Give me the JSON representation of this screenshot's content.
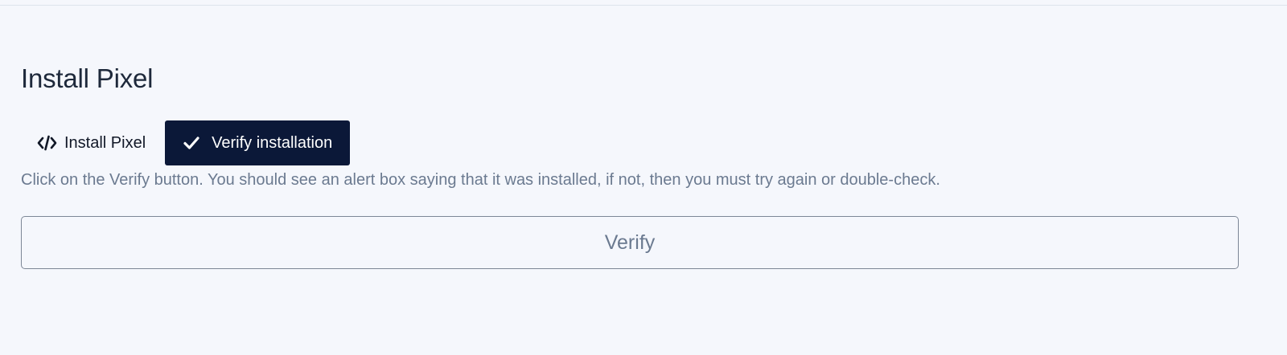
{
  "page": {
    "title": "Install Pixel"
  },
  "tabs": [
    {
      "label": "Install Pixel",
      "icon": "code-icon",
      "active": false
    },
    {
      "label": "Verify installation",
      "icon": "check-icon",
      "active": true
    }
  ],
  "instructions": "Click on the Verify button. You should see an alert box saying that it was installed, if not, then you must try again or double-check.",
  "verify": {
    "label": "Verify"
  },
  "colors": {
    "background": "#f5f7fc",
    "active_tab": "#0b1838",
    "muted_text": "#6b7a90",
    "button_border": "#7d8796"
  }
}
